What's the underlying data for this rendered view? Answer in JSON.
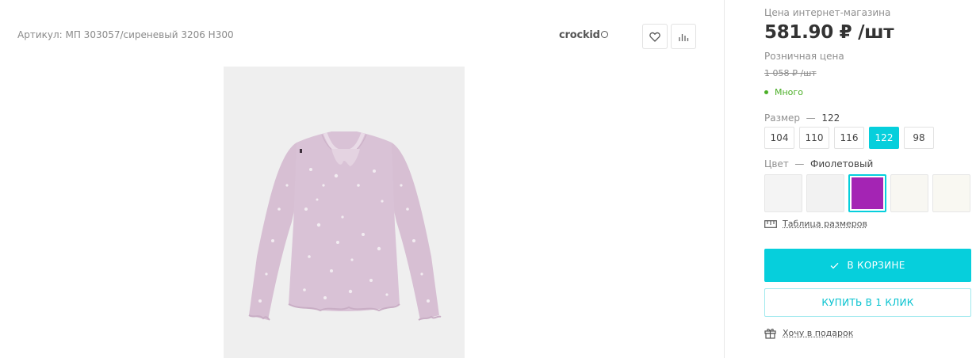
{
  "product": {
    "sku": "Артикул: МП 303057/сиреневый 3206 H300",
    "brand": "crockid",
    "image_icon": "shirt-image"
  },
  "actions": {
    "favorite_icon": "heart-icon",
    "compare_icon": "bar-chart-icon"
  },
  "pricing": {
    "online_label": "Цена интернет-магазина",
    "online_price": "581.90 ₽ /шт",
    "retail_label": "Розничная цена",
    "retail_price": "1 058 ₽ /шт",
    "stock": "Много",
    "stock_color": "#4caf28"
  },
  "size": {
    "label": "Размер",
    "dash": "—",
    "selected": "122",
    "options": [
      "104",
      "110",
      "116",
      "122",
      "98"
    ]
  },
  "color": {
    "label": "Цвет",
    "dash": "—",
    "selected": "Фиолетовый",
    "swatches": [
      "#f4f4f4",
      "#f2f2f2",
      "#a424b4",
      "#f8f7f2",
      "#f9f8f2"
    ]
  },
  "links": {
    "size_table": "Таблица размеров",
    "gift": "Хочу в подарок"
  },
  "buttons": {
    "cart": "В КОРЗИНЕ",
    "one_click": "КУПИТЬ В 1 КЛИК"
  },
  "colors": {
    "accent": "#06cfdc",
    "garment": "#d7bfd3"
  }
}
